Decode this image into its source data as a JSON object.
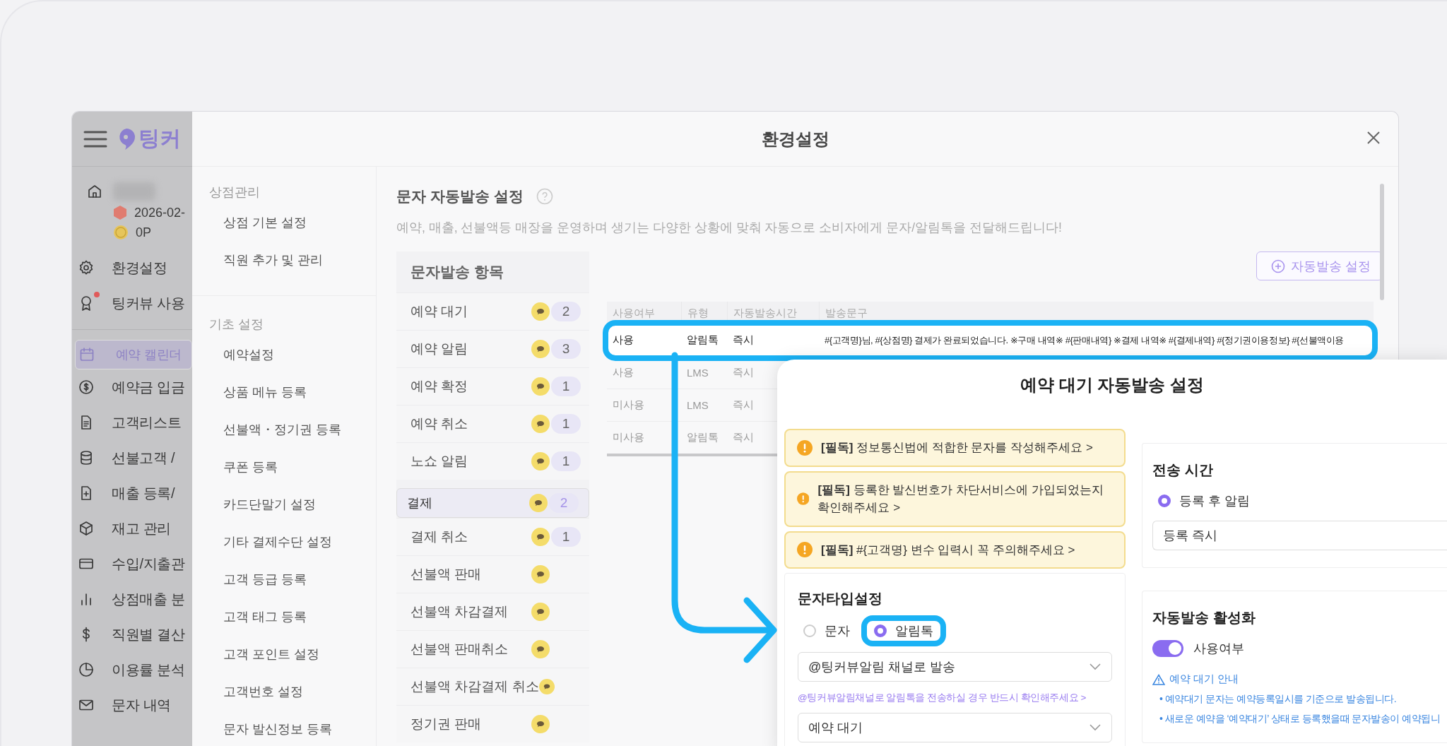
{
  "sidebar": {
    "logo": "팅커",
    "account": {
      "date": "2026-02-",
      "points": "0P"
    },
    "top_items": [
      {
        "label": "환경설정",
        "selected": false,
        "new": false
      },
      {
        "label": "팅커뷰 사용",
        "selected": false,
        "new": true
      }
    ],
    "items": [
      {
        "label": "예약 캘린더",
        "selected": true
      },
      {
        "label": "예약금 입금",
        "selected": false
      },
      {
        "label": "고객리스트",
        "selected": false
      },
      {
        "label": "선불고객 /",
        "selected": false
      },
      {
        "label": "매출 등록/",
        "selected": false
      },
      {
        "label": "재고 관리",
        "selected": false
      },
      {
        "label": "수입/지출관",
        "selected": false
      },
      {
        "label": "상점매출 분",
        "selected": false
      },
      {
        "label": "직원별 결산",
        "selected": false
      },
      {
        "label": "이용률 분석",
        "selected": false
      },
      {
        "label": "문자 내역",
        "selected": false
      }
    ]
  },
  "modal": {
    "title": "환경설정",
    "nav": [
      {
        "title": "상점관리",
        "items": [
          "상점 기본 설정",
          "직원 추가 및 관리"
        ]
      },
      {
        "title": "기초 설정",
        "items": [
          "예약설정",
          "상품 메뉴 등록",
          "선불액・정기권 등록",
          "쿠폰 등록",
          "카드단말기 설정",
          "기타 결제수단 설정",
          "고객 등급 등록",
          "고객 태그 등록",
          "고객 포인트 설정",
          "고객번호 설정",
          "문자 발신정보 등록"
        ]
      }
    ],
    "heading": "문자 자동발송 설정",
    "description": "예약, 매출, 선불액등 매장을 운영하며 생기는 다양한 상황에 맞춰 자동으로 소비자에게 문자/알림톡을 전달해드립니다!",
    "list_title": "문자발송 항목",
    "list": [
      {
        "label": "예약 대기",
        "count": "2",
        "selected": false
      },
      {
        "label": "예약 알림",
        "count": "3",
        "selected": false
      },
      {
        "label": "예약 확정",
        "count": "1",
        "selected": false
      },
      {
        "label": "예약 취소",
        "count": "1",
        "selected": false
      },
      {
        "label": "노쇼 알림",
        "count": "1",
        "selected": false
      },
      {
        "label": "결제",
        "count": "2",
        "selected": true
      },
      {
        "label": "결제 취소",
        "count": "1",
        "selected": false
      },
      {
        "label": "선불액 판매",
        "selected": false
      },
      {
        "label": "선불액 차감결제",
        "selected": false
      },
      {
        "label": "선불액 판매취소",
        "selected": false
      },
      {
        "label": "선불액 차감결제 취소",
        "selected": false
      },
      {
        "label": "정기권 판매",
        "selected": false
      }
    ],
    "add_button": "자동발송 설정",
    "table": {
      "columns": [
        "사용여부",
        "유형",
        "자동발송시간",
        "발송문구"
      ],
      "rows": [
        {
          "cells": [
            "사용",
            "알림톡",
            "즉시",
            "#{고객명}님, #{상점명} 결제가 완료되었습니다. ※구매 내역※ #{판매내역} ※결제 내역※ #{결제내역} #{정기권이용정보} #{선불액이용"
          ],
          "highlighted": true
        },
        {
          "cells": [
            "사용",
            "LMS",
            "즉시"
          ],
          "highlighted": false
        },
        {
          "cells": [
            "미사용",
            "LMS",
            "즉시"
          ],
          "highlighted": false
        },
        {
          "cells": [
            "미사용",
            "알림톡",
            "즉시"
          ],
          "highlighted": false
        }
      ]
    }
  },
  "popup": {
    "title": "예약 대기 자동발송 설정",
    "notices": [
      "**[필독]** 정보통신법에 적합한 문자를 작성해주세요 >",
      "**[필독]** 등록한 발신번호가 차단서비스에 가입되었는지 확인해주세요 >",
      "**[필독]** #{고객명} 변수 입력시 꼭 주의해주세요 >"
    ],
    "type_card": {
      "title": "문자타입설정",
      "options": [
        {
          "label": "문자",
          "selected": false,
          "highlighted": false
        },
        {
          "label": "알림톡",
          "selected": true,
          "highlighted": true
        }
      ],
      "channel_select": "@팅커뷰알림 채널로 발송",
      "channel_link": "@팅커뷰알림채널로 알림톡을 전송하실 경우 반드시 확인해주세요 >",
      "template_select": "예약 대기"
    },
    "time_card": {
      "title": "전송 시간",
      "option": {
        "label": "등록 후 알림",
        "selected": true
      },
      "select": "등록 즉시"
    },
    "activation_card": {
      "title": "자동발송 활성화",
      "toggle": {
        "label": "사용여부",
        "on": true
      },
      "notice_title": "예약 대기 안내",
      "notice_items": [
        "• 예약대기 문자는 예약등록일시를 기준으로 발송됩니다.",
        "• 새로운 예약을 ‘예약대기’ 상태로 등록했을때 문자발송이 예약됩니"
      ]
    }
  }
}
